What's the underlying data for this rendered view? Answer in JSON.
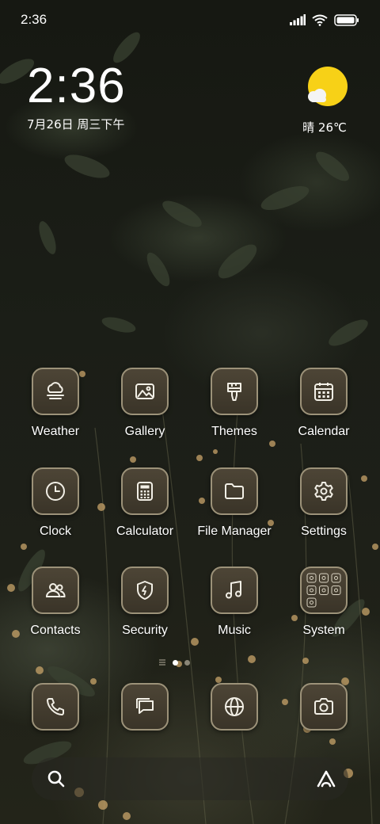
{
  "status_bar": {
    "time": "2:36",
    "icons": [
      "signal-icon",
      "wifi-icon",
      "battery-icon"
    ]
  },
  "clock_widget": {
    "time": "2:36",
    "date": "7月26日 周三下午"
  },
  "weather_widget": {
    "icon": "sunny-cloud-icon",
    "text": "晴 26℃",
    "sun_color": "#f7d117"
  },
  "apps": [
    {
      "label": "Weather",
      "icon": "cloud-fog-icon"
    },
    {
      "label": "Gallery",
      "icon": "image-icon"
    },
    {
      "label": "Themes",
      "icon": "paintbrush-icon"
    },
    {
      "label": "Calendar",
      "icon": "calendar-icon"
    },
    {
      "label": "Clock",
      "icon": "clock-icon"
    },
    {
      "label": "Calculator",
      "icon": "calculator-icon"
    },
    {
      "label": "File Manager",
      "icon": "folder-icon"
    },
    {
      "label": "Settings",
      "icon": "gear-icon"
    },
    {
      "label": "Contacts",
      "icon": "contacts-icon"
    },
    {
      "label": "Security",
      "icon": "shield-bolt-icon"
    },
    {
      "label": "Music",
      "icon": "music-note-icon"
    },
    {
      "label": "System",
      "icon": "app-folder-icon"
    }
  ],
  "page_indicator": {
    "pages": 2,
    "current": 1
  },
  "dock": [
    {
      "name": "phone",
      "icon": "phone-icon"
    },
    {
      "name": "messages",
      "icon": "message-icon"
    },
    {
      "name": "browser",
      "icon": "globe-icon"
    },
    {
      "name": "camera",
      "icon": "camera-icon"
    }
  ],
  "search_bar": {
    "left_icon": "search-icon",
    "right_icon": "assistant-icon"
  },
  "colors": {
    "icon_fill": "#3f382c",
    "icon_border": "#9c9279",
    "glyph": "#f2efe6"
  }
}
